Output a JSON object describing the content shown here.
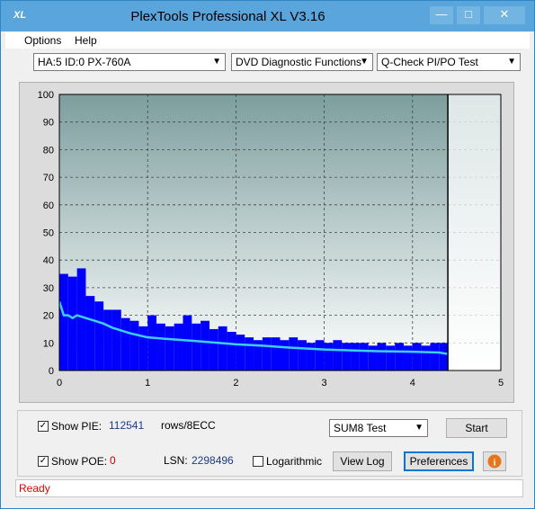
{
  "window": {
    "title": "PlexTools Professional XL V3.16",
    "icon_name": "xl-app-icon"
  },
  "menu": [
    {
      "label": "Options"
    },
    {
      "label": "Help"
    }
  ],
  "toolbar": {
    "drive": "HA:5 ID:0  PX-760A",
    "function": "DVD Diagnostic Functions",
    "test": "Q-Check PI/PO Test"
  },
  "chart_data": {
    "type": "area",
    "ylim": [
      0,
      100
    ],
    "xlim": [
      0,
      5
    ],
    "y_ticks": [
      0,
      10,
      20,
      30,
      40,
      50,
      60,
      70,
      80,
      90,
      100
    ],
    "x_ticks": [
      0,
      1,
      2,
      3,
      4,
      5
    ],
    "grid": true,
    "end_marker_x": 4.4,
    "series": [
      {
        "kind": "bars",
        "color": "#0000ff",
        "x": [
          0.0,
          0.1,
          0.2,
          0.3,
          0.4,
          0.5,
          0.6,
          0.7,
          0.8,
          0.9,
          1.0,
          1.1,
          1.2,
          1.3,
          1.4,
          1.5,
          1.6,
          1.7,
          1.8,
          1.9,
          2.0,
          2.1,
          2.2,
          2.3,
          2.4,
          2.5,
          2.6,
          2.7,
          2.8,
          2.9,
          3.0,
          3.1,
          3.2,
          3.3,
          3.4,
          3.5,
          3.6,
          3.7,
          3.8,
          3.9,
          4.0,
          4.1,
          4.2,
          4.3,
          4.4
        ],
        "y": [
          35,
          34,
          37,
          27,
          25,
          22,
          22,
          19,
          18,
          16,
          20,
          17,
          16,
          17,
          20,
          17,
          18,
          15,
          16,
          14,
          13,
          12,
          11,
          12,
          12,
          11,
          12,
          11,
          10,
          11,
          10,
          11,
          10,
          10,
          10,
          9,
          10,
          9,
          10,
          9,
          10,
          9,
          10,
          10,
          9
        ]
      },
      {
        "kind": "line",
        "color": "#3cd0f0",
        "x": [
          0.0,
          0.05,
          0.1,
          0.15,
          0.2,
          0.3,
          0.4,
          0.5,
          0.6,
          0.8,
          1.0,
          1.2,
          1.5,
          1.8,
          2.0,
          2.3,
          2.6,
          3.0,
          3.3,
          3.6,
          4.0,
          4.3,
          4.4
        ],
        "y": [
          25,
          20,
          20,
          19,
          20,
          19,
          18,
          17,
          15.5,
          13.5,
          12,
          11.5,
          10.8,
          10,
          9.5,
          9,
          8.3,
          7.6,
          7.3,
          7,
          6.8,
          6.5,
          6
        ]
      }
    ]
  },
  "options": {
    "show_pie_label": "Show PIE:",
    "pie_value": "112541",
    "pie_unit": "rows/8ECC",
    "show_poe_label": "Show POE:",
    "poe_value": "0",
    "lsn_label": "LSN:",
    "lsn_value": "2298496",
    "log_label": "Logarithmic",
    "sum_mode": "SUM8 Test",
    "start_label": "Start",
    "viewlog_label": "View Log",
    "prefs_label": "Preferences"
  },
  "status": {
    "text": "Ready"
  }
}
